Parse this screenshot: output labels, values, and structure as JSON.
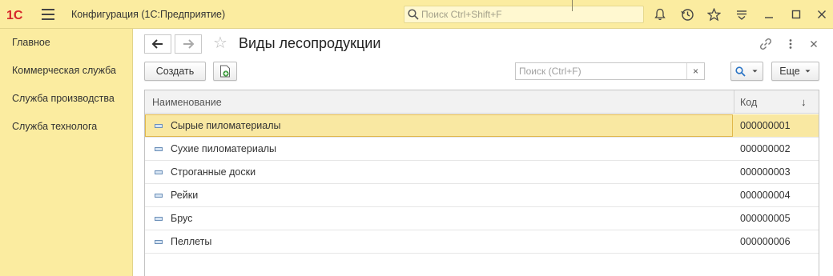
{
  "app": {
    "title": "Конфигурация  (1С:Предприятие)",
    "logo_text": "1С",
    "global_search_placeholder": "Поиск Ctrl+Shift+F"
  },
  "sidebar": {
    "items": [
      {
        "label": "Главное"
      },
      {
        "label": "Коммерческая служба"
      },
      {
        "label": "Служба производства"
      },
      {
        "label": "Служба технолога"
      }
    ]
  },
  "form": {
    "title": "Виды лесопродукции",
    "create_label": "Создать",
    "more_label": "Еще",
    "search_placeholder": "Поиск (Ctrl+F)",
    "search_clear": "×"
  },
  "table": {
    "columns": [
      {
        "label": "Наименование"
      },
      {
        "label": "Код",
        "sort": "↓"
      }
    ],
    "rows": [
      {
        "name": "Сырые пиломатериалы",
        "code": "000000001",
        "selected": true
      },
      {
        "name": "Сухие пиломатериалы",
        "code": "000000002"
      },
      {
        "name": "Строганные доски",
        "code": "000000003"
      },
      {
        "name": "Рейки",
        "code": "000000004"
      },
      {
        "name": "Брус",
        "code": "000000005"
      },
      {
        "name": "Пеллеты",
        "code": "000000006"
      }
    ]
  },
  "colors": {
    "panel_yellow": "#fbeca0",
    "selected_row": "#f9e8a2",
    "logo_red": "#d6252b",
    "accent_blue": "#2a74c5",
    "create_green": "#3a9a3a"
  }
}
